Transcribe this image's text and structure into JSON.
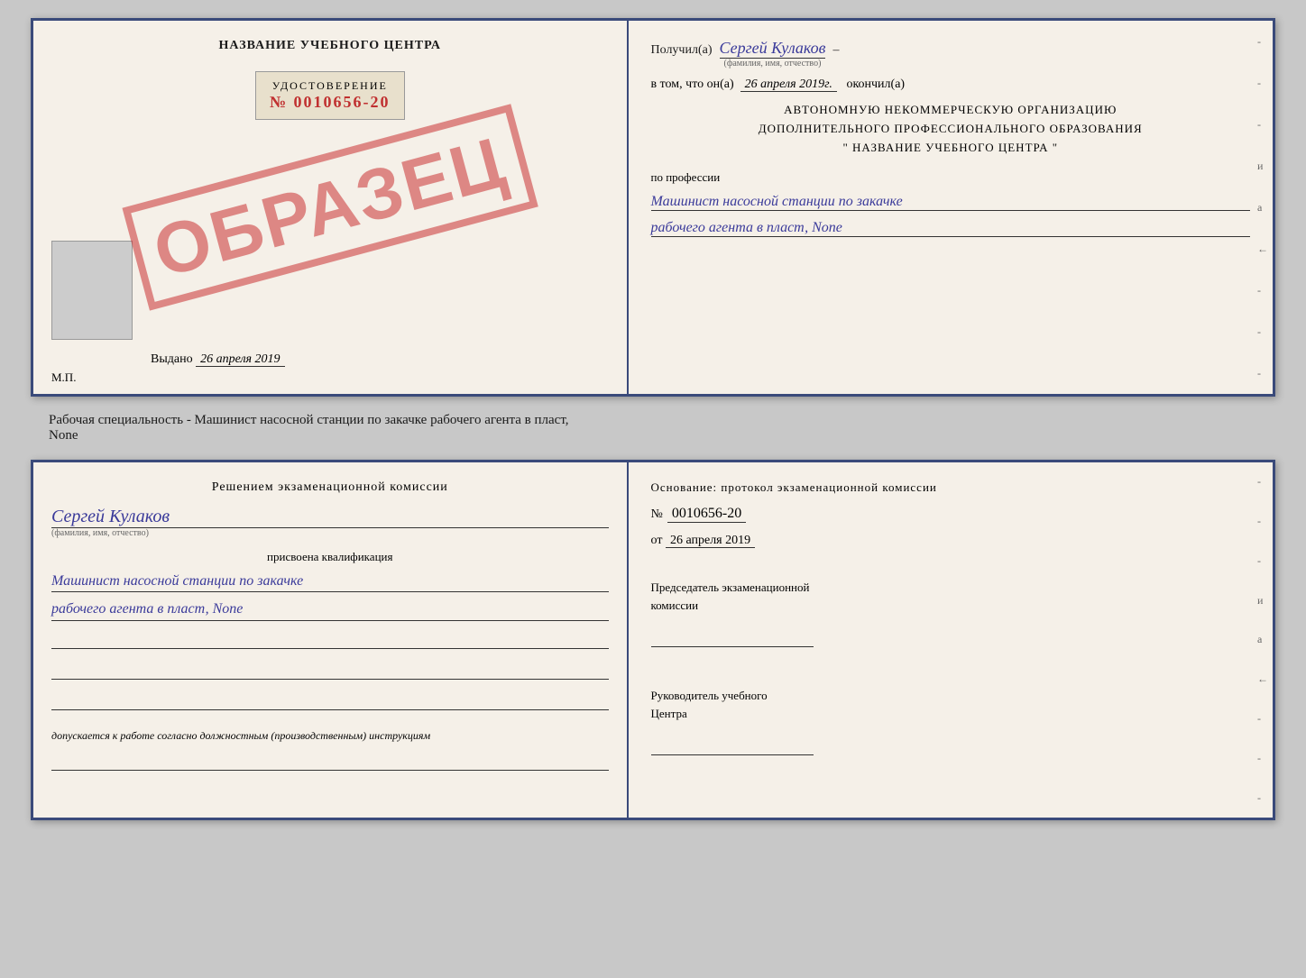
{
  "topDoc": {
    "left": {
      "title": "НАЗВАНИЕ УЧЕБНОГО ЦЕНТРА",
      "stamp": "ОБРАЗЕЦ",
      "udostLabel": "УДОСТОВЕРЕНИЕ",
      "udostNumber": "№ 0010656-20",
      "vydanoLabel": "Выдано",
      "vydanoDate": "26 апреля 2019",
      "mpLabel": "М.П."
    },
    "right": {
      "poluchilLabel": "Получил(а)",
      "recipientName": "Сергей Кулаков",
      "fioLabel": "(фамилия, имя, отчество)",
      "dash": "–",
      "vTomLabel": "в том, что он(а)",
      "date": "26 апреля 2019г.",
      "okonchilLabel": "окончил(а)",
      "orgLine1": "АВТОНОМНУЮ НЕКОММЕРЧЕСКУЮ ОРГАНИЗАЦИЮ",
      "orgLine2": "ДОПОЛНИТЕЛЬНОГО ПРОФЕССИОНАЛЬНОГО ОБРАЗОВАНИЯ",
      "orgLine3": "\"   НАЗВАНИЕ УЧЕБНОГО ЦЕНТРА   \"",
      "professionLabel": "по профессии",
      "professionLine1": "Машинист насосной станции по закачке",
      "professionLine2": "рабочего агента в пласт, None",
      "dashes": [
        "-",
        "-",
        "-",
        "и",
        "а",
        "←",
        "-",
        "-",
        "-"
      ]
    }
  },
  "middleText": {
    "line1": "Рабочая специальность - Машинист насосной станции по закачке рабочего агента в пласт,",
    "line2": "None"
  },
  "bottomDoc": {
    "left": {
      "commissionTitle": "Решением экзаменационной комиссии",
      "personName": "Сергей Кулаков",
      "fioLabel": "(фамилия, имя, отчество)",
      "assignedLabel": "присвоена квалификация",
      "qualLine1": "Машинист насосной станции по закачке",
      "qualLine2": "рабочего агента в пласт, None",
      "dopuskaetsya": "допускается к  работе согласно должностным (производственным) инструкциям"
    },
    "right": {
      "osnovanieTitle": "Основание: протокол экзаменационной комиссии",
      "protocolNoLabel": "№",
      "protocolNumber": "0010656-20",
      "otLabel": "от",
      "protocolDate": "26 апреля 2019",
      "chairmanLabel": "Председатель экзаменационной",
      "chairmanLabel2": "комиссии",
      "headLabel": "Руководитель учебного",
      "headLabel2": "Центра",
      "dashes": [
        "-",
        "-",
        "-",
        "и",
        "а",
        "←",
        "-",
        "-",
        "-"
      ]
    }
  }
}
